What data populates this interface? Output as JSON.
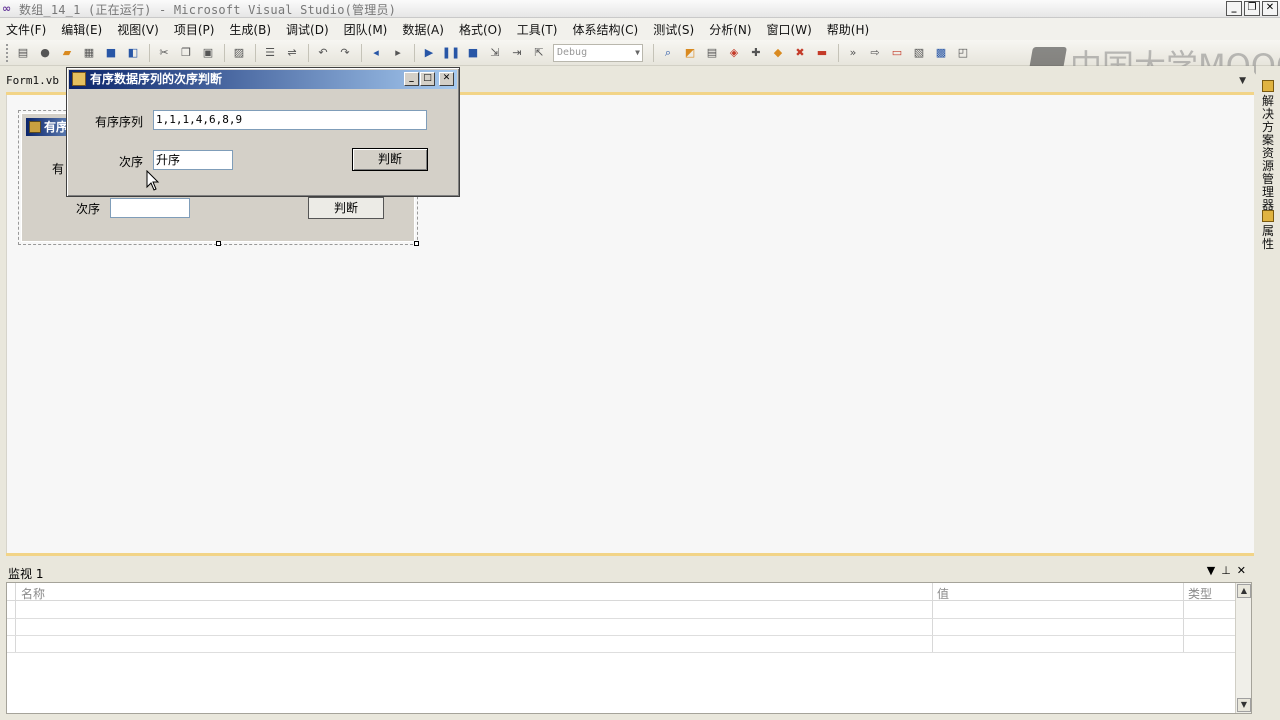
{
  "window": {
    "title": "数组_14_1 (正在运行) - Microsoft Visual Studio(管理员)",
    "min": "_",
    "restore": "❐",
    "close": "✕"
  },
  "menu": [
    "文件(F)",
    "编辑(E)",
    "视图(V)",
    "项目(P)",
    "生成(B)",
    "调试(D)",
    "团队(M)",
    "数据(A)",
    "格式(O)",
    "工具(T)",
    "体系结构(C)",
    "测试(S)",
    "分析(N)",
    "窗口(W)",
    "帮助(H)"
  ],
  "toolbar": {
    "config": "Debug"
  },
  "watermark": "中国大学MOOC",
  "doc_tab": "Form1.vb",
  "design_form": {
    "title": "有序",
    "label1": "有",
    "label2": "次序",
    "button": "判断"
  },
  "dialog": {
    "title": "有序数据序列的次序判断",
    "seq_label": "有序序列",
    "seq_value": "1,1,1,4,6,8,9",
    "order_label": "次序",
    "order_value": "升序",
    "button": "判断"
  },
  "side_tabs": [
    "解决方案资源管理器",
    "属性"
  ],
  "watch": {
    "title": "监视 1",
    "columns": [
      "名称",
      "值",
      "类型"
    ]
  }
}
